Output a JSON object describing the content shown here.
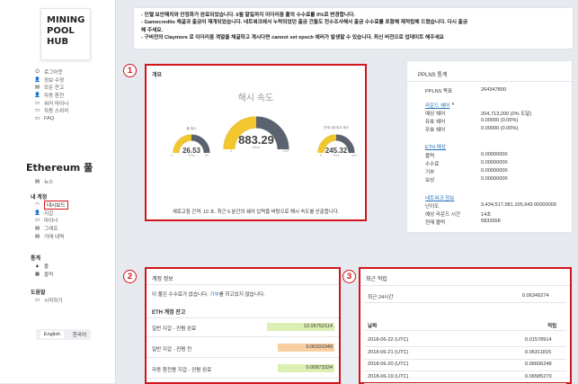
{
  "logo": {
    "line1": "MINING",
    "line2": "POOL",
    "line3": "HUB"
  },
  "menu_main": [
    {
      "icon": "power-icon",
      "glyph": "⏻",
      "label": "로그아웃"
    },
    {
      "icon": "user-icon",
      "glyph": "👤",
      "label": "정보 수정"
    },
    {
      "icon": "wallet-icon",
      "glyph": "▤",
      "label": "모든 잔고"
    },
    {
      "icon": "user-icon",
      "glyph": "👤",
      "label": "자동 환전"
    },
    {
      "icon": "monitor-icon",
      "glyph": "▭",
      "label": "워커 마이너"
    },
    {
      "icon": "monitor-icon",
      "glyph": "▭",
      "label": "자동 스위치"
    },
    {
      "icon": "chat-icon",
      "glyph": "▭",
      "label": "FAQ"
    }
  ],
  "coin_title": "Ethereum 풀",
  "menu_news": {
    "icon": "news-icon",
    "glyph": "▤",
    "label": "뉴스"
  },
  "section_account": "내 계정",
  "menu_account": [
    {
      "icon": "dashboard-icon",
      "glyph": "◠",
      "label": "대시보드"
    },
    {
      "icon": "user-icon",
      "glyph": "👤",
      "label": "지갑"
    },
    {
      "icon": "monitor-icon",
      "glyph": "▭",
      "label": "마이너"
    },
    {
      "icon": "chart-icon",
      "glyph": "▤",
      "label": "그래프"
    },
    {
      "icon": "list-icon",
      "glyph": "▤",
      "label": "거래 내역"
    }
  ],
  "section_stats": "통계",
  "menu_stats": [
    {
      "icon": "home-icon",
      "glyph": "▲",
      "label": "풀"
    },
    {
      "icon": "blocks-icon",
      "glyph": "▦",
      "label": "블럭"
    }
  ],
  "section_help": "도움말",
  "menu_help": [
    {
      "icon": "monitor-icon",
      "glyph": "▭",
      "label": "시작하기"
    }
  ],
  "lang": {
    "en": "English",
    "ko": "한국어"
  },
  "notice": [
    "- 인텔 보안패치와 안정화가 완료되었습니다. 6월 말일까지 이더리움 풀의 수수료를 0%로 변경합니다.",
    "- Gamecredits 채굴과 출금이 재개되었습니다. 네트워크에서 누락되었던 출금 건들도 전수조사해서 출금 수수료를 포함해 재적립해 드렸습니다. 다시 출금",
    "해 주세요.",
    "- 구버전의 Claymore 로 이더리움 계열을 채굴하고 계시다면 cannot set epoch 에러가 발생할 수 있습니다. 최신 버전으로 업데이트 해주세요"
  ],
  "badges": {
    "b1": "1",
    "b2": "2",
    "b3": "3"
  },
  "overview": {
    "title": "개요",
    "gauge_title": "해시 속도",
    "main_value": "883.29",
    "main_unit": "MH/s",
    "main_min": "0",
    "main_max": "1767",
    "main_fill": 0.5,
    "left_label": "풀 해시",
    "left_value": "26.53",
    "left_unit": "TH/s",
    "left_min": "0",
    "left_max": "53",
    "left_fill": 0.5,
    "right_label": "전체 네트워크 해시",
    "right_value": "245.32",
    "right_unit": "TH/s",
    "right_min": "0",
    "right_max": "491",
    "right_fill": 0.5,
    "footer": "새로고침 간격: 10 초. 최근 5 분간의 쉐어 입력을 바탕으로 해시 속도를 산출합니다."
  },
  "pplns": {
    "title": "PPLNS 통계",
    "target_label": "PPLNS 목표",
    "target_value": "264347800",
    "round_share_link": "라운드 쉐어",
    "valid_label": "예상 쉐어",
    "valid_value": "204,713,200 (0% 도달)",
    "valid2_label": "유효 쉐어",
    "valid2_value": "0.00000 (0.00%)",
    "invalid_label": "무효 쉐어",
    "invalid_value": "0.00000 (0.00%)",
    "eth_link": "ETH 예상",
    "block_label": "블럭",
    "block_value": "0.00000000",
    "fee_label": "수수료",
    "fee_value": "0.00000000",
    "donation_label": "기부",
    "donation_value": "0.00000000",
    "reward_label": "보상",
    "reward_value": "0.00000000",
    "network_link": "네트워크 정보",
    "difficulty_label": "난이도",
    "difficulty_value": "3,434,517,581,105,943.00000000",
    "round_time_label": "예상 라운드 시간",
    "round_time_value": "14초",
    "current_block_label": "현재 블럭",
    "current_block_value": "5832658"
  },
  "account": {
    "title": "계정 정보",
    "note_prefix": "이 풀은 수수료가 없습니다. ",
    "note_link": "기부",
    "note_suffix": "를 하고있지 않습니다.",
    "balance_title": "ETH 계정 잔고",
    "rows": [
      {
        "label": "일반 지갑 - 컨펌 완료",
        "value": "12.05752114",
        "color": "#dcefb2",
        "fill": 1.0
      },
      {
        "label": "일반 지갑 - 컨펌 전",
        "value": "0.00101049",
        "color": "#f7cfa0",
        "fill": 0.84
      },
      {
        "label": "자동 환전용 지갑 - 컨펌 완료",
        "value": "0.00873324",
        "color": "#dcefb2",
        "fill": 0.84
      }
    ]
  },
  "recent": {
    "title": "최근 적립",
    "last24_label": "최근 24시간",
    "last24_value": "0.06349274",
    "col_date": "날짜",
    "col_amount": "적립",
    "rows": [
      {
        "date": "2018-06-22 (UTC)",
        "amount": "0.01578914"
      },
      {
        "date": "2018-06-21 (UTC)",
        "amount": "0.06311815"
      },
      {
        "date": "2018-06-20 (UTC)",
        "amount": "0.06606248"
      },
      {
        "date": "2018-06-19 (UTC)",
        "amount": "0.06585270"
      }
    ]
  }
}
